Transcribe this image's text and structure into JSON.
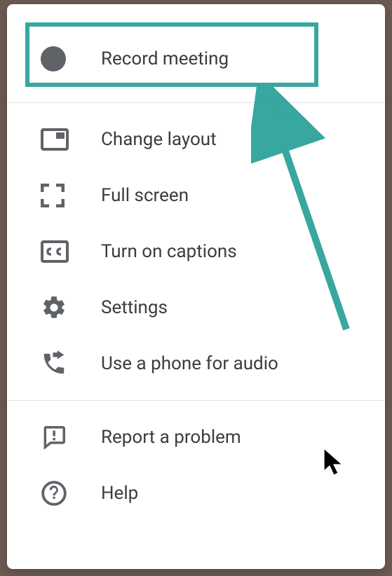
{
  "menu": {
    "record": "Record meeting",
    "layout": "Change layout",
    "fullscreen": "Full screen",
    "captions": "Turn on captions",
    "settings": "Settings",
    "phoneaudio": "Use a phone for audio",
    "report": "Report a problem",
    "help": "Help"
  },
  "annotations": {
    "highlight": true,
    "arrow": true,
    "cursorVisible": true
  },
  "colors": {
    "accent": "#38a7a0",
    "icon": "#5f6368"
  }
}
